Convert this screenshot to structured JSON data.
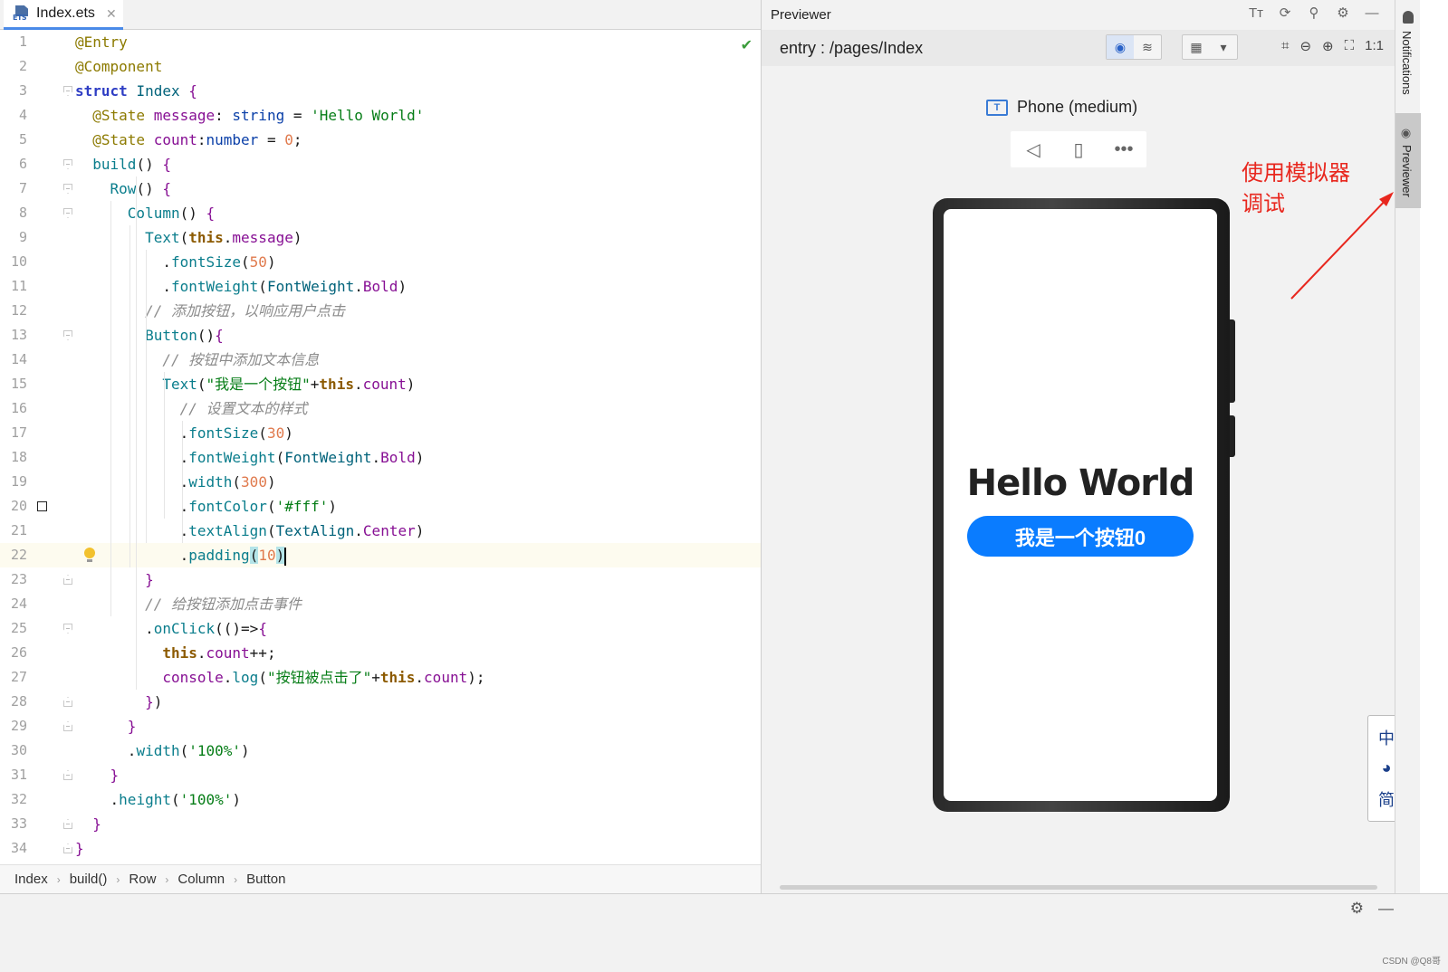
{
  "editor": {
    "tab": {
      "name": "Index.ets",
      "icon": "ets-file-icon",
      "icon_text": "ETS"
    },
    "lines": [
      {
        "n": "1",
        "html": "<span class='dec'>@Entry</span>"
      },
      {
        "n": "2",
        "html": "<span class='dec'>@Component</span>"
      },
      {
        "n": "3",
        "html": "<span class='kw'>struct</span> <span class='ty'>Index</span> <span class='prop'>{</span>"
      },
      {
        "n": "4",
        "html": "  <span class='dec'>@State</span> <span class='prop'>message</span>: <span class='k'>string</span> = <span class='str'>'Hello World'</span>"
      },
      {
        "n": "5",
        "html": "  <span class='dec'>@State</span> <span class='prop'>count</span>:<span class='k'>number</span> = <span class='num'>0</span>;"
      },
      {
        "n": "6",
        "html": "  <span class='fn'>build</span>() <span class='prop'>{</span>"
      },
      {
        "n": "7",
        "html": "    <span class='fn'>Row</span>() <span class='prop'>{</span>"
      },
      {
        "n": "8",
        "html": "      <span class='fn'>Column</span>() <span class='prop'>{</span>"
      },
      {
        "n": "9",
        "html": "        <span class='fn'>Text</span>(<span class='this'>this</span>.<span class='prop'>message</span>)"
      },
      {
        "n": "10",
        "html": "          .<span class='fn'>fontSize</span>(<span class='num'>50</span>)"
      },
      {
        "n": "11",
        "html": "          .<span class='fn'>fontWeight</span>(<span class='ty'>FontWeight</span>.<span class='prop'>Bold</span>)"
      },
      {
        "n": "12",
        "html": "        <span class='cm'>// 添加按钮，以响应用户点击</span>"
      },
      {
        "n": "13",
        "html": "        <span class='fn'>Button</span>()<span class='prop'>{</span>"
      },
      {
        "n": "14",
        "html": "          <span class='cm'>// 按钮中添加文本信息</span>"
      },
      {
        "n": "15",
        "html": "          <span class='fn'>Text</span>(<span class='str'>\"我是一个按钮\"</span>+<span class='this'>this</span>.<span class='prop'>count</span>)"
      },
      {
        "n": "16",
        "html": "            <span class='cm'>// 设置文本的样式</span>"
      },
      {
        "n": "17",
        "html": "            .<span class='fn'>fontSize</span>(<span class='num'>30</span>)"
      },
      {
        "n": "18",
        "html": "            .<span class='fn'>fontWeight</span>(<span class='ty'>FontWeight</span>.<span class='prop'>Bold</span>)"
      },
      {
        "n": "19",
        "html": "            .<span class='fn'>width</span>(<span class='num'>300</span>)"
      },
      {
        "n": "20",
        "html": "            .<span class='fn'>fontColor</span>(<span class='str'>'#fff'</span>)"
      },
      {
        "n": "21",
        "html": "            .<span class='fn'>textAlign</span>(<span class='ty'>TextAlign</span>.<span class='prop'>Center</span>)"
      },
      {
        "n": "22",
        "html": "            .<span class='fn'>padding</span><span class='hl'>(</span><span class='num'>10</span><span class='hl'>)</span><span class='caret'></span>"
      },
      {
        "n": "23",
        "html": "        <span class='prop'>}</span>"
      },
      {
        "n": "24",
        "html": "        <span class='cm'>// 给按钮添加点击事件</span>"
      },
      {
        "n": "25",
        "html": "        .<span class='fn'>onClick</span>(()=&gt;<span class='prop'>{</span>"
      },
      {
        "n": "26",
        "html": "          <span class='this'>this</span>.<span class='prop'>count</span>++;"
      },
      {
        "n": "27",
        "html": "          <span class='prop'>console</span>.<span class='fn'>log</span>(<span class='str'>\"按钮被点击了\"</span>+<span class='this'>this</span>.<span class='prop'>count</span>);"
      },
      {
        "n": "28",
        "html": "        <span class='prop'>}</span>)"
      },
      {
        "n": "29",
        "html": "      <span class='prop'>}</span>"
      },
      {
        "n": "30",
        "html": "      .<span class='fn'>width</span>(<span class='str'>'100%'</span>)"
      },
      {
        "n": "31",
        "html": "    <span class='prop'>}</span>"
      },
      {
        "n": "32",
        "html": "    .<span class='fn'>height</span>(<span class='str'>'100%'</span>)"
      },
      {
        "n": "33",
        "html": "  <span class='prop'>}</span>"
      },
      {
        "n": "34",
        "html": "<span class='prop'>}</span>"
      }
    ],
    "current_line": "22",
    "breadcrumbs": [
      "Index",
      "build()",
      "Row",
      "Column",
      "Button"
    ]
  },
  "previewer": {
    "title": "Previewer",
    "route": "entry : /pages/Index",
    "device_label": "Phone (medium)",
    "app": {
      "hello_text": "Hello World",
      "button_text": "我是一个按钮0",
      "button_color": "#0a7cff"
    },
    "annotation": "使用模拟器\n调试",
    "ime": [
      "中",
      "◕",
      "简"
    ],
    "zoom_label": "1:1"
  },
  "side_strip": {
    "notifications": "Notifications",
    "previewer": "Previewer"
  },
  "footer_credit": "CSDN @Q8哥"
}
